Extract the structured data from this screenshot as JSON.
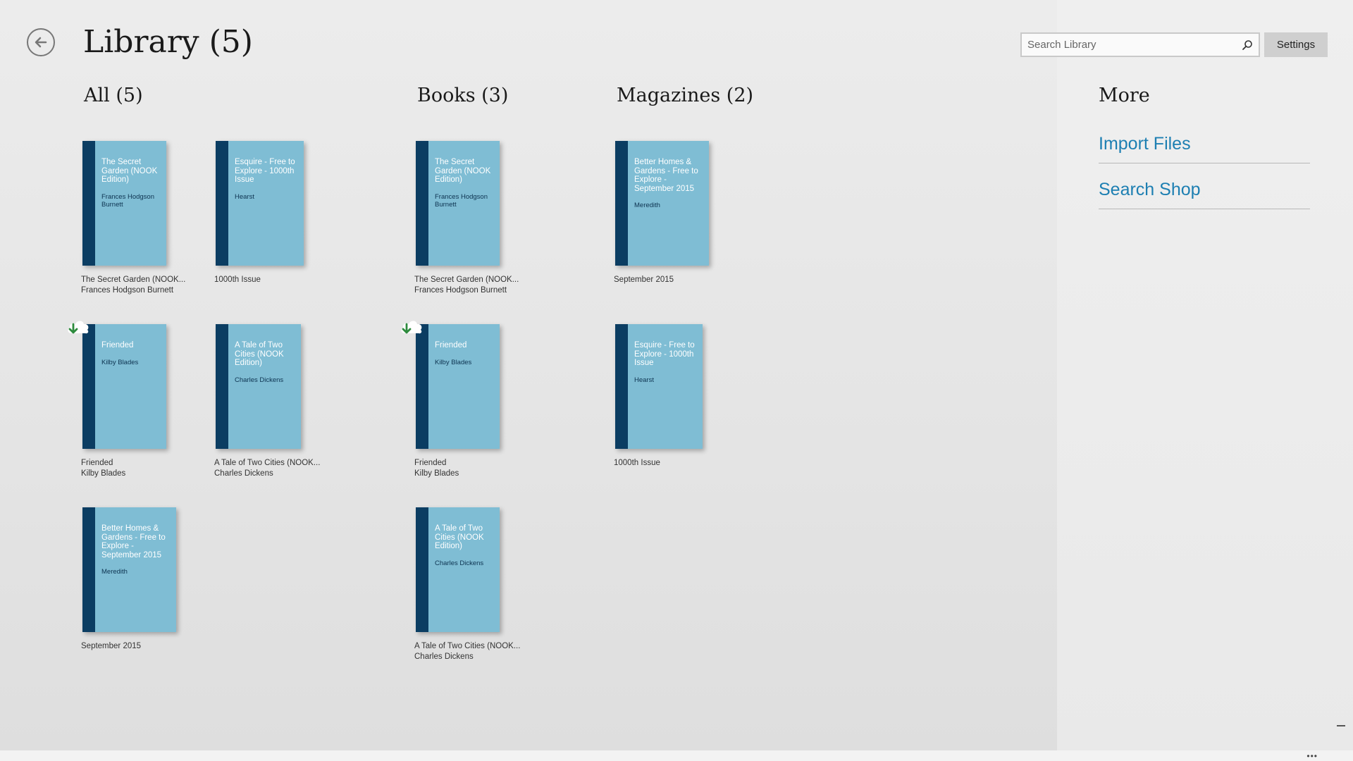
{
  "header": {
    "title": "Library (5)",
    "search_placeholder": "Search Library",
    "settings_label": "Settings"
  },
  "sections": {
    "all": "All (5)",
    "books": "Books (3)",
    "magazines": "Magazines (2)"
  },
  "items": [
    {
      "cover_title": "The Secret Garden (NOOK Edition)",
      "cover_author": "Frances Hodgson Burnett",
      "caption_title": "The Secret Garden (NOOK...",
      "caption_sub": "Frances Hodgson Burnett",
      "cloud": false
    },
    {
      "cover_title": "Esquire - Free to Explore - 1000th Issue",
      "cover_author": "Hearst",
      "caption_title": "1000th Issue",
      "caption_sub": "",
      "cloud": false
    },
    {
      "cover_title": "The Secret Garden (NOOK Edition)",
      "cover_author": "Frances Hodgson Burnett",
      "caption_title": "The Secret Garden (NOOK...",
      "caption_sub": "Frances Hodgson Burnett",
      "cloud": false
    },
    {
      "cover_title": "Better Homes & Gardens - Free to Explore - September 2015",
      "cover_author": "Meredith",
      "caption_title": "September 2015",
      "caption_sub": "",
      "cloud": false
    },
    {
      "cover_title": "Friended",
      "cover_author": "Kilby Blades",
      "caption_title": "Friended",
      "caption_sub": "Kilby Blades",
      "cloud": true
    },
    {
      "cover_title": "A Tale of Two Cities (NOOK Edition)",
      "cover_author": "Charles Dickens",
      "caption_title": "A Tale of Two Cities (NOOK...",
      "caption_sub": "Charles Dickens",
      "cloud": false
    },
    {
      "cover_title": "Friended",
      "cover_author": "Kilby Blades",
      "caption_title": "Friended",
      "caption_sub": "Kilby Blades",
      "cloud": true
    },
    {
      "cover_title": "Esquire - Free to Explore - 1000th Issue",
      "cover_author": "Hearst",
      "caption_title": "1000th Issue",
      "caption_sub": "",
      "cloud": false
    },
    {
      "cover_title": "Better Homes & Gardens - Free to Explore - September 2015",
      "cover_author": "Meredith",
      "caption_title": "September 2015",
      "caption_sub": "",
      "cloud": false
    },
    {
      "cover_title": "A Tale of Two Cities (NOOK Edition)",
      "cover_author": "Charles Dickens",
      "caption_title": "A Tale of Two Cities (NOOK...",
      "caption_sub": "Charles Dickens",
      "cloud": false
    }
  ],
  "more": {
    "title": "More",
    "links": [
      "Import Files",
      "Search Shop"
    ]
  },
  "app_bar": {
    "dots": "•••"
  },
  "colors": {
    "cover": "#7fbdd4",
    "spine": "#0b3d62",
    "link": "#1d7fb2",
    "download_arrow": "#2e8b3e"
  },
  "icons": [
    "back-arrow-icon",
    "search-icon",
    "cloud-download-icon"
  ]
}
